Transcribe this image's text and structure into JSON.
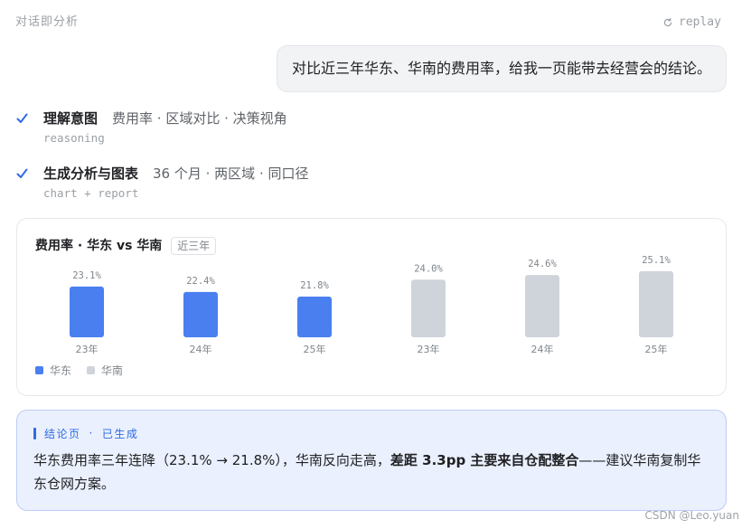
{
  "header": {
    "title": "对话即分析",
    "replay_icon": "replay-icon",
    "replay_label": "replay"
  },
  "user_message": "对比近三年华东、华南的费用率，给我一页能带去经营会的结论。",
  "steps": [
    {
      "status_icon": "check-icon",
      "title": "理解意图",
      "detail": "费用率 · 区域对比 · 决策视角",
      "tag": "reasoning"
    },
    {
      "status_icon": "check-icon",
      "title": "生成分析与图表",
      "detail": "36 个月 · 两区域 · 同口径",
      "tag": "chart + report"
    }
  ],
  "chart_data": {
    "type": "bar",
    "title": "费用率 · 华东 vs 华南",
    "period_badge": "近三年",
    "categories": [
      "23年",
      "24年",
      "25年"
    ],
    "series": [
      {
        "name": "华东",
        "values": [
          23.1,
          22.4,
          21.8
        ],
        "color": "#4a7ff0"
      },
      {
        "name": "华南",
        "values": [
          24.0,
          24.6,
          25.1
        ],
        "color": "#cfd4db"
      }
    ],
    "value_suffix": "%",
    "grid": false,
    "legend": "bottom-left"
  },
  "conclusion": {
    "label": "结论页",
    "separator": "·",
    "status": "已生成",
    "text_before": "华东费用率三年连降（23.1% → 21.8%），华南反向走高，",
    "text_bold": "差距 3.3pp 主要来自仓配整合",
    "text_after": "——建议华南复制华东仓网方案。"
  },
  "colors": {
    "accent": "#2f6be6",
    "conclusion_bg": "#eaf0fd",
    "muted_text": "#9aa0a6"
  },
  "watermark": "CSDN @Leo.yuan"
}
